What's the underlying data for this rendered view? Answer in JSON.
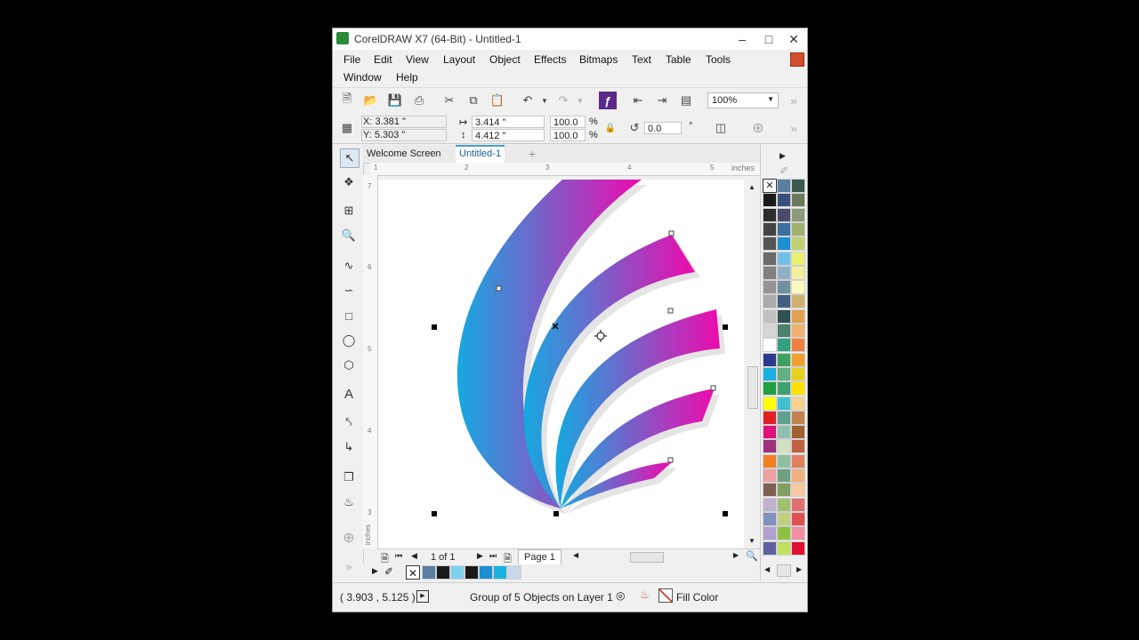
{
  "window": {
    "title": "CorelDRAW X7 (64-Bit) - Untitled-1"
  },
  "menu": {
    "items": [
      "File",
      "Edit",
      "View",
      "Layout",
      "Object",
      "Effects",
      "Bitmaps",
      "Text",
      "Table",
      "Tools",
      "Window",
      "Help"
    ]
  },
  "toolbar": {
    "zoom": "100%"
  },
  "properties": {
    "x": "X:  3.381 \"",
    "y": "Y:  5.303 \"",
    "width": "3.414 \"",
    "height": "4.412 \"",
    "scale_w": "100.0",
    "scale_h": "100.0",
    "pct_symbol": "%",
    "rotation": "0.0",
    "degree_symbol": "°"
  },
  "tabs": {
    "welcome": "Welcome Screen",
    "doc": "Untitled-1",
    "add": "+"
  },
  "ruler": {
    "units": "inches",
    "h_ticks": [
      "1",
      "2",
      "3",
      "4",
      "5"
    ],
    "v_ticks": [
      "7",
      "6",
      "5",
      "4",
      "3"
    ],
    "v_units": "inches"
  },
  "pagebar": {
    "page_count": "1 of 1",
    "page_tab": "Page 1"
  },
  "status": {
    "coords": "( 3.903 , 5.125 )",
    "selection": "Group of 5 Objects on Layer 1",
    "fill": "Fill Color"
  },
  "colors": {
    "gradient_start": "#15a9e0",
    "gradient_end": "#ee0aad",
    "palette": [
      [
        "#ffffff",
        "#5a7fa0",
        "#3a5a50"
      ],
      [
        "#1a1a1a",
        "#3a4f7a",
        "#6a7a5a"
      ],
      [
        "#2d2d2d",
        "#4a4a6a",
        "#8a9a7a"
      ],
      [
        "#444444",
        "#3a6fa0",
        "#a0b070"
      ],
      [
        "#555555",
        "#1a90d0",
        "#c0d070"
      ],
      [
        "#6a6a6a",
        "#70c0e8",
        "#e8f070"
      ],
      [
        "#808080",
        "#90b0c8",
        "#f0f0a0"
      ],
      [
        "#959595",
        "#7090a0",
        "#f8f8c0"
      ],
      [
        "#aaaaaa",
        "#406080",
        "#d0b070"
      ],
      [
        "#c0c0c0",
        "#305050",
        "#e0a050"
      ],
      [
        "#d5d5d5",
        "#508070",
        "#f0b070"
      ],
      [
        "#ffffff",
        "#30a080",
        "#f08040"
      ],
      [
        "#2a3a90",
        "#40a060",
        "#f0a030"
      ],
      [
        "#1ab0e0",
        "#60b080",
        "#e8d020"
      ],
      [
        "#20a040",
        "#40a070",
        "#ffe000"
      ],
      [
        "#ffff00",
        "#40c0d0",
        "#f8d090"
      ],
      [
        "#e02020",
        "#60a090",
        "#c08050"
      ],
      [
        "#e0107a",
        "#90c0b0",
        "#a06030"
      ],
      [
        "#a03080",
        "#d0e0c0",
        "#c06040"
      ],
      [
        "#f08020",
        "#90c0a0",
        "#e08060"
      ],
      [
        "#f0a0a0",
        "#70a080",
        "#f0b080"
      ],
      [
        "#806050",
        "#80a060",
        "#f8c8a0"
      ],
      [
        "#c0b0d0",
        "#a0c070",
        "#e07070"
      ],
      [
        "#8090c0",
        "#c0d080",
        "#e05050"
      ],
      [
        "#b0a0d0",
        "#90c040",
        "#f090a0"
      ],
      [
        "#6060a0",
        "#c0e060",
        "#e01030"
      ]
    ],
    "doc_palette": [
      "#5a7fa0",
      "#1a1a1a",
      "#7fd0f0",
      "#1a1a1a",
      "#1a90d0",
      "#1ab0e0",
      "#c8d8e8"
    ]
  }
}
